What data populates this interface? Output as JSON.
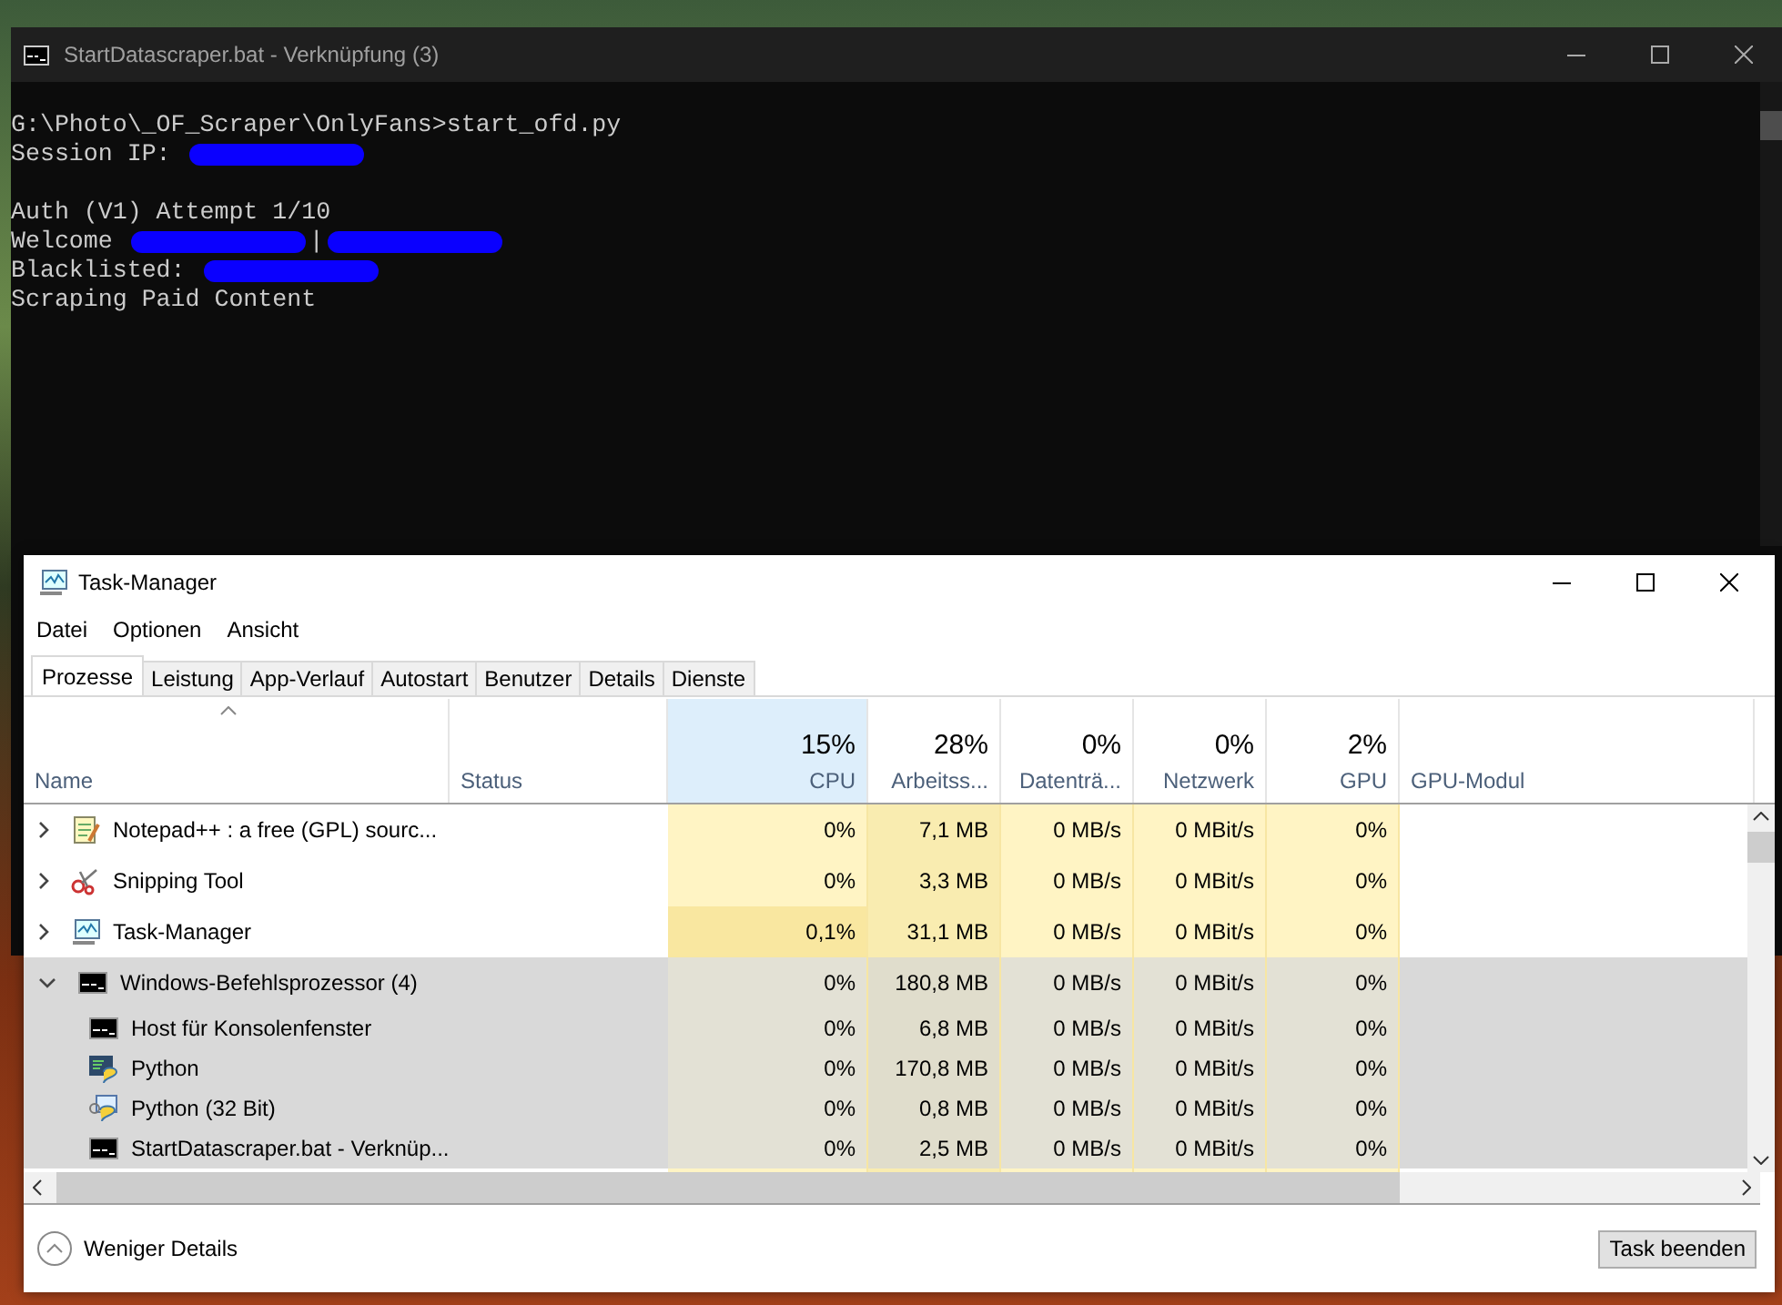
{
  "console": {
    "title": "StartDatascraper.bat - Verknüpfung (3)",
    "lines": [
      {
        "kind": "output",
        "parts": [
          {
            "kind": "text",
            "text": "G:\\Photo\\_OF_Scraper\\OnlyFans>start_ofd.py"
          }
        ]
      },
      {
        "kind": "output",
        "parts": [
          {
            "kind": "text",
            "text": "Session IP: "
          },
          {
            "kind": "redacted"
          }
        ]
      },
      {
        "kind": "blank"
      },
      {
        "kind": "output",
        "parts": [
          {
            "kind": "text",
            "text": "Auth (V1) Attempt 1/10"
          }
        ]
      },
      {
        "kind": "output",
        "parts": [
          {
            "kind": "text",
            "text": "Welcome "
          },
          {
            "kind": "redacted"
          },
          {
            "kind": "text",
            "text": "|"
          },
          {
            "kind": "redacted"
          }
        ]
      },
      {
        "kind": "output",
        "parts": [
          {
            "kind": "text",
            "text": "Blacklisted: "
          },
          {
            "kind": "redacted"
          }
        ]
      },
      {
        "kind": "output",
        "parts": [
          {
            "kind": "text",
            "text": "Scraping Paid Content"
          }
        ]
      }
    ]
  },
  "task_manager": {
    "title": "Task-Manager",
    "menu": [
      "Datei",
      "Optionen",
      "Ansicht"
    ],
    "tabs": [
      {
        "label": "Prozesse",
        "selected": true
      },
      {
        "label": "Leistung",
        "selected": false
      },
      {
        "label": "App-Verlauf",
        "selected": false
      },
      {
        "label": "Autostart",
        "selected": false
      },
      {
        "label": "Benutzer",
        "selected": false
      },
      {
        "label": "Details",
        "selected": false
      },
      {
        "label": "Dienste",
        "selected": false
      }
    ],
    "columns": [
      {
        "label": "Name",
        "kind": "name",
        "sorted": true,
        "highlighted": false
      },
      {
        "label": "Status",
        "kind": "status",
        "sorted": false,
        "highlighted": false
      },
      {
        "label": "CPU",
        "usage": "15%",
        "kind": "metric",
        "sorted": false,
        "highlighted": true
      },
      {
        "label": "Arbeitss...",
        "usage": "28%",
        "kind": "metric",
        "sorted": false,
        "highlighted": false
      },
      {
        "label": "Datenträ...",
        "usage": "0%",
        "kind": "metric",
        "sorted": false,
        "highlighted": false
      },
      {
        "label": "Netzwerk",
        "usage": "0%",
        "kind": "metric",
        "sorted": false,
        "highlighted": false
      },
      {
        "label": "GPU",
        "usage": "2%",
        "kind": "metric",
        "sorted": false,
        "highlighted": false
      },
      {
        "label": "GPU-Modul",
        "kind": "text",
        "sorted": false,
        "highlighted": false
      }
    ],
    "rows": [
      {
        "kind": "notepad",
        "expanded": false,
        "selected": false,
        "cells": [
          "Notepad++ : a free (GPL) sourc...",
          "",
          "0%",
          "7,1 MB",
          "0 MB/s",
          "0 MBit/s",
          "0%"
        ]
      },
      {
        "kind": "snipping",
        "expanded": false,
        "selected": false,
        "cells": [
          "Snipping Tool",
          "",
          "0%",
          "3,3 MB",
          "0 MB/s",
          "0 MBit/s",
          "0%"
        ]
      },
      {
        "kind": "taskmgr",
        "expanded": false,
        "selected": false,
        "cells": [
          "Task-Manager",
          "",
          "0,1%",
          "31,1 MB",
          "0 MB/s",
          "0 MBit/s",
          "0%"
        ]
      },
      {
        "kind": "console",
        "expanded": true,
        "selected": true,
        "cells": [
          "Windows-Befehlsprozessor (4)",
          "",
          "0%",
          "180,8 MB",
          "0 MB/s",
          "0 MBit/s",
          "0%"
        ],
        "children": [
          {
            "kind": "console",
            "cells": [
              "Host für Konsolenfenster",
              "",
              "0%",
              "6,8 MB",
              "0 MB/s",
              "0 MBit/s",
              "0%"
            ]
          },
          {
            "kind": "python",
            "cells": [
              "Python",
              "",
              "0%",
              "170,8 MB",
              "0 MB/s",
              "0 MBit/s",
              "0%"
            ]
          },
          {
            "kind": "python32",
            "cells": [
              "Python (32 Bit)",
              "",
              "0%",
              "0,8 MB",
              "0 MB/s",
              "0 MBit/s",
              "0%"
            ]
          },
          {
            "kind": "console",
            "cells": [
              "StartDatascraper.bat - Verknüp...",
              "",
              "0%",
              "2,5 MB",
              "0 MB/s",
              "0 MBit/s",
              "0%"
            ]
          }
        ]
      }
    ],
    "footer": {
      "details": "Weniger Details",
      "end_task": "Task beenden"
    }
  }
}
